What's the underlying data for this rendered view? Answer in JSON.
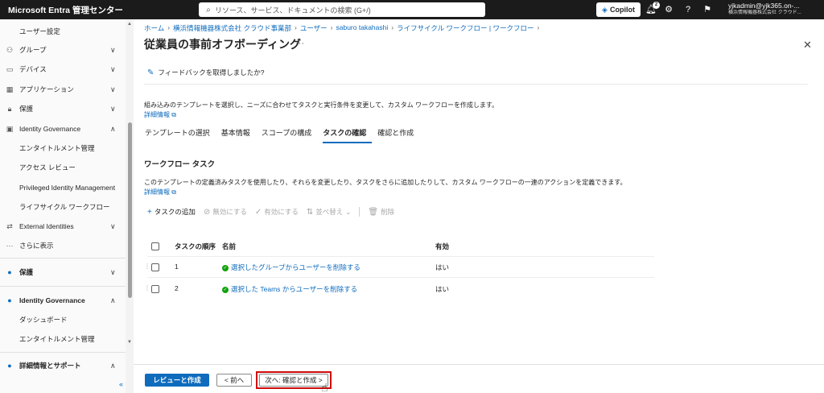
{
  "topbar": {
    "brand": "Microsoft Entra 管理センター",
    "search_placeholder": "リソース、サービス、ドキュメントの検索 (G+/)",
    "copilot_label": "Copilot",
    "notification_count": "2",
    "account_name": "yjkadmin@yjk365.on-...",
    "account_org": "横浜情報機器株式会社 クラウド..."
  },
  "sidebar": {
    "items": [
      {
        "label": "ユーザー設定",
        "icon": "",
        "chevron": ""
      },
      {
        "label": "グループ",
        "icon": "group-icon",
        "chevron": "∨"
      },
      {
        "label": "デバイス",
        "icon": "device-icon",
        "chevron": "∨"
      },
      {
        "label": "アプリケーション",
        "icon": "app-icon",
        "chevron": "∨"
      },
      {
        "label": "保護",
        "icon": "lock-icon",
        "chevron": "∨"
      },
      {
        "label": "Identity Governance",
        "icon": "governance-icon",
        "chevron": "∧"
      },
      {
        "label": "エンタイトルメント管理",
        "icon": "",
        "chevron": ""
      },
      {
        "label": "アクセス レビュー",
        "icon": "",
        "chevron": ""
      },
      {
        "label": "Privileged Identity Management",
        "icon": "",
        "chevron": ""
      },
      {
        "label": "ライフサイクル ワークフロー",
        "icon": "",
        "chevron": ""
      },
      {
        "label": "External Identities",
        "icon": "external-icon",
        "chevron": "∨"
      },
      {
        "label": "さらに表示",
        "icon": "more-icon",
        "chevron": ""
      },
      {
        "label": "保護",
        "icon": "protection-icon",
        "chevron": "∨"
      },
      {
        "label": "Identity Governance",
        "icon": "governance-icon",
        "chevron": "∧"
      },
      {
        "label": "ダッシュボード",
        "icon": "",
        "chevron": ""
      },
      {
        "label": "エンタイトルメント管理",
        "icon": "",
        "chevron": ""
      },
      {
        "label": "詳細情報とサポート",
        "icon": "support-icon",
        "chevron": "∧"
      }
    ],
    "collapse": "«"
  },
  "breadcrumb": [
    "ホーム",
    "横浜情報機器株式会社 クラウド事業部",
    "ユーザー",
    "saburo takahashi",
    "ライフサイクル ワークフロー | ワークフロー"
  ],
  "page": {
    "title": "従業員の事前オフボーディング",
    "more": "···",
    "close": "✕",
    "feedback": "フィードバックを取得しましたか?",
    "description": "組み込みのテンプレートを選択し、ニーズに合わせてタスクと実行条件を変更して、カスタム ワークフローを作成します。",
    "learn_more": "詳細情報",
    "tabs": [
      "テンプレートの選択",
      "基本情報",
      "スコープの構成",
      "タスクの確認",
      "確認と作成"
    ],
    "active_tab": 3,
    "section_title": "ワークフロー タスク",
    "section_desc": "このテンプレートの定義済みタスクを使用したり、それらを変更したり、タスクをさらに追加したりして、カスタム ワークフローの一連のアクションを定義できます。",
    "section_learn_more": "詳細情報"
  },
  "toolbar": {
    "add": "タスクの追加",
    "disable": "無効にする",
    "enable": "有効にする",
    "reorder": "並べ替え",
    "delete": "削除"
  },
  "table": {
    "headers": [
      "タスクの順序",
      "名前",
      "有効"
    ],
    "rows": [
      {
        "order": "1",
        "name": "選択したグループからユーザーを削除する",
        "enabled": "はい"
      },
      {
        "order": "2",
        "name": "選択した Teams からユーザーを削除する",
        "enabled": "はい"
      }
    ]
  },
  "footer": {
    "review_create": "レビューと作成",
    "previous": "< 前へ",
    "next": "次へ: 確認と作成 >"
  },
  "colors": {
    "accent": "#0f6cbd",
    "topbar": "#1b1b1b",
    "highlight": "#d10a0a",
    "success": "#13a10e"
  }
}
